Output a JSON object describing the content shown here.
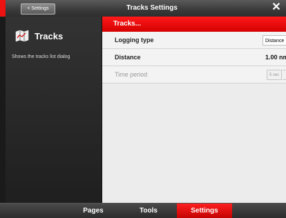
{
  "titlebar": {
    "back_label": "< Settings",
    "title": "Tracks Settings",
    "close_label": "✕"
  },
  "left_panel": {
    "icon": "map-icon",
    "title": "Tracks",
    "description": "Shows the tracks list dialog"
  },
  "content": {
    "section_title": "Tracks...",
    "rows": [
      {
        "label": "Logging type",
        "value": "Distance",
        "enabled": true
      },
      {
        "label": "Distance",
        "value": "1.00 nm",
        "enabled": true
      },
      {
        "label": "Time period",
        "value": "5 sec",
        "enabled": false
      }
    ]
  },
  "bottom_tabs": [
    {
      "label": "Pages",
      "active": false
    },
    {
      "label": "Tools",
      "active": false
    },
    {
      "label": "Settings",
      "active": true
    }
  ],
  "colors": {
    "accent": "#e00000",
    "panel": "#2a2a2a",
    "content_bg": "#ececec"
  }
}
